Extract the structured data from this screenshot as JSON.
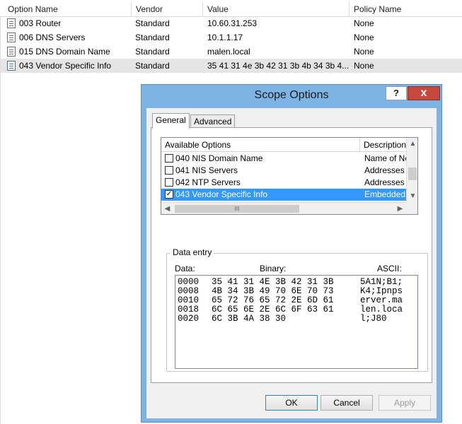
{
  "list": {
    "columns": [
      "Option Name",
      "Vendor",
      "Value",
      "Policy Name"
    ],
    "rows": [
      {
        "name": "003 Router",
        "vendor": "Standard",
        "value": "10.60.31.253",
        "policy": "None"
      },
      {
        "name": "006 DNS Servers",
        "vendor": "Standard",
        "value": "10.1.1.17",
        "policy": "None"
      },
      {
        "name": "015 DNS Domain Name",
        "vendor": "Standard",
        "value": "malen.local",
        "policy": "None"
      },
      {
        "name": "043 Vendor Specific Info",
        "vendor": "Standard",
        "value": "35 41 31 4e 3b 42 31 3b 4b 34 3b 4...",
        "policy": "None"
      }
    ],
    "selected_row": 3
  },
  "dialog": {
    "title": "Scope Options",
    "help_label": "?",
    "close_label": "x",
    "tabs": [
      {
        "label": "General",
        "active": true
      },
      {
        "label": "Advanced",
        "active": false
      }
    ],
    "available_options": {
      "headers": [
        "Available Options",
        "Description"
      ],
      "rows": [
        {
          "name": "040 NIS Domain Name",
          "desc": "Name of Ne",
          "checked": false
        },
        {
          "name": "041 NIS Servers",
          "desc": "Addresses c",
          "checked": false
        },
        {
          "name": "042 NTP Servers",
          "desc": "Addresses c",
          "checked": false
        },
        {
          "name": "043 Vendor Specific Info",
          "desc": "Embedded v",
          "checked": true
        }
      ],
      "selected_row": 3,
      "hscroll_grip": "III"
    },
    "data_entry": {
      "group_label": "Data entry",
      "col_data": "Data:",
      "col_binary": "Binary:",
      "col_ascii": "ASCII:",
      "lines": [
        {
          "offset": "0000",
          "binary": "35 41 31 4E 3B 42 31 3B",
          "ascii": "5A1N;B1;"
        },
        {
          "offset": "0008",
          "binary": "4B 34 3B 49 70 6E 70 73",
          "ascii": "K4;Ipnps"
        },
        {
          "offset": "0010",
          "binary": "65 72 76 65 72 2E 6D 61",
          "ascii": "erver.ma"
        },
        {
          "offset": "0018",
          "binary": "6C 65 6E 2E 6C 6F 63 61",
          "ascii": "len.loca"
        },
        {
          "offset": "0020",
          "binary": "6C 3B 4A 38 30",
          "ascii": "l;J80"
        }
      ]
    },
    "buttons": {
      "ok": "OK",
      "cancel": "Cancel",
      "apply": "Apply"
    }
  }
}
